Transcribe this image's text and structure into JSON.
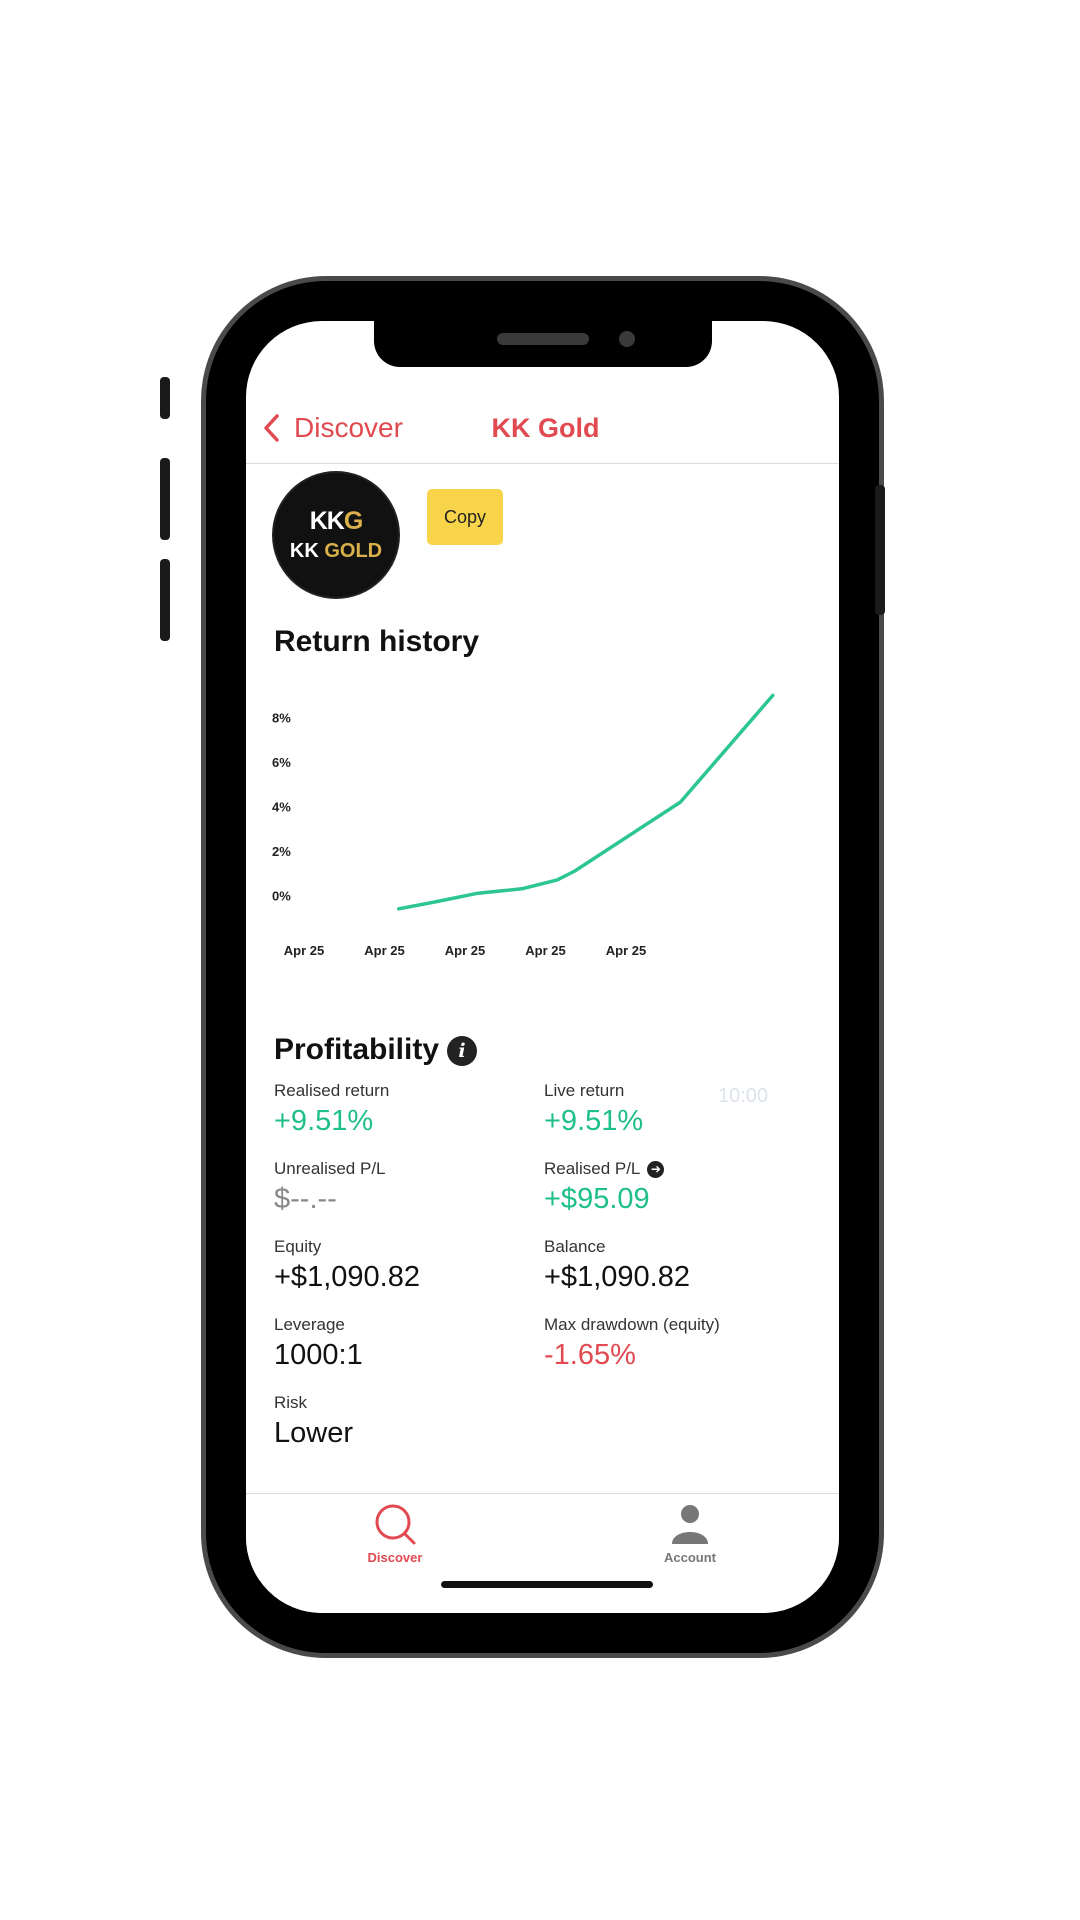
{
  "nav": {
    "back_label": "Discover",
    "title": "KK Gold"
  },
  "profile": {
    "logo_monogram": "KK",
    "logo_monogram_g": "G",
    "logo_word_kk": "KK",
    "logo_word_gold": "GOLD",
    "copy_label": "Copy"
  },
  "return_history": {
    "title": "Return history"
  },
  "chart_data": {
    "type": "line",
    "title": "Return history",
    "x_ticks": [
      "Apr 25",
      "Apr 25",
      "Apr 25",
      "Apr 25",
      "Apr 25"
    ],
    "y_ticks": [
      "0%",
      "2%",
      "4%",
      "6%",
      "8%"
    ],
    "y_unit": "%",
    "ylim": [
      -0.7,
      9.2
    ],
    "x": [
      0.6,
      1.0,
      1.5,
      2.0,
      2.4,
      2.6,
      3.8,
      4.85
    ],
    "series": [
      {
        "values": [
          -0.6,
          -0.3,
          0.1,
          0.3,
          0.7,
          1.1,
          4.2,
          9.0
        ]
      }
    ],
    "xlim": [
      0,
      5
    ],
    "grid": false,
    "color": "#2cc594"
  },
  "profitability": {
    "title": "Profitability",
    "ghost_time": "10:00",
    "metrics": {
      "realised_return": {
        "label": "Realised return",
        "value": "+9.51%"
      },
      "live_return": {
        "label": "Live return",
        "value": "+9.51%"
      },
      "unrealised_pl": {
        "label": "Unrealised P/L",
        "value": "$--.--"
      },
      "realised_pl": {
        "label": "Realised P/L",
        "value": "+$95.09"
      },
      "equity": {
        "label": "Equity",
        "value": "+$1,090.82"
      },
      "balance": {
        "label": "Balance",
        "value": "+$1,090.82"
      },
      "leverage": {
        "label": "Leverage",
        "value": "1000:1"
      },
      "max_drawdown": {
        "label": "Max drawdown (equity)",
        "value": "-1.65%"
      },
      "risk": {
        "label": "Risk",
        "value": "Lower"
      }
    }
  },
  "tabbar": {
    "discover_label": "Discover",
    "account_label": "Account",
    "active_color": "#e04a50",
    "inactive_color": "#777777"
  }
}
